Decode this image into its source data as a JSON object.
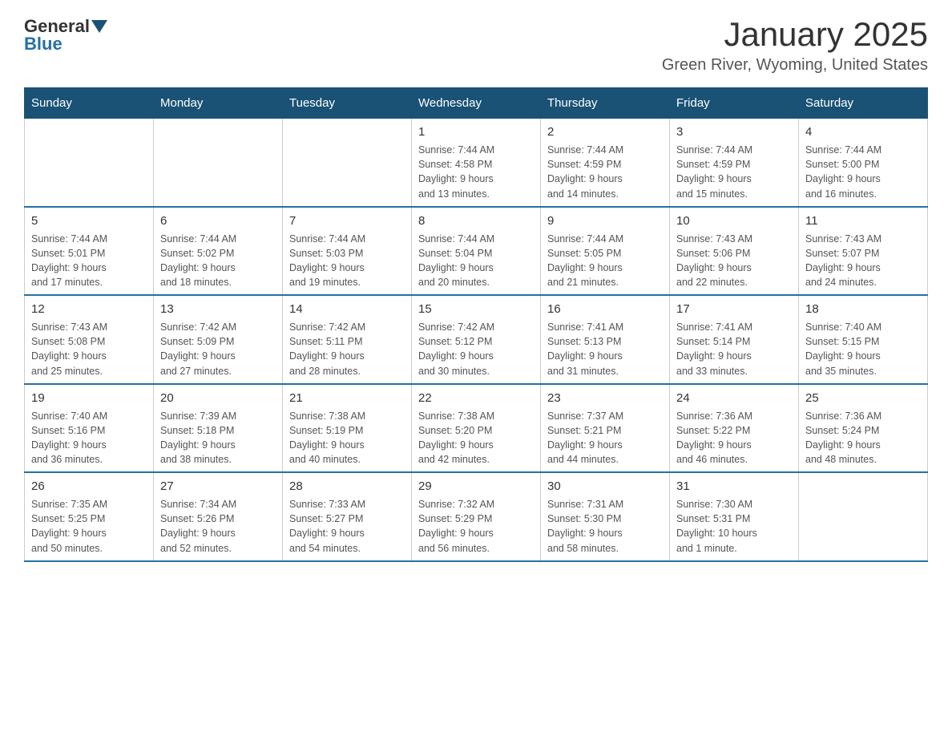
{
  "logo": {
    "general": "General",
    "blue": "Blue"
  },
  "title": "January 2025",
  "subtitle": "Green River, Wyoming, United States",
  "days_of_week": [
    "Sunday",
    "Monday",
    "Tuesday",
    "Wednesday",
    "Thursday",
    "Friday",
    "Saturday"
  ],
  "weeks": [
    [
      {
        "day": "",
        "info": ""
      },
      {
        "day": "",
        "info": ""
      },
      {
        "day": "",
        "info": ""
      },
      {
        "day": "1",
        "info": "Sunrise: 7:44 AM\nSunset: 4:58 PM\nDaylight: 9 hours\nand 13 minutes."
      },
      {
        "day": "2",
        "info": "Sunrise: 7:44 AM\nSunset: 4:59 PM\nDaylight: 9 hours\nand 14 minutes."
      },
      {
        "day": "3",
        "info": "Sunrise: 7:44 AM\nSunset: 4:59 PM\nDaylight: 9 hours\nand 15 minutes."
      },
      {
        "day": "4",
        "info": "Sunrise: 7:44 AM\nSunset: 5:00 PM\nDaylight: 9 hours\nand 16 minutes."
      }
    ],
    [
      {
        "day": "5",
        "info": "Sunrise: 7:44 AM\nSunset: 5:01 PM\nDaylight: 9 hours\nand 17 minutes."
      },
      {
        "day": "6",
        "info": "Sunrise: 7:44 AM\nSunset: 5:02 PM\nDaylight: 9 hours\nand 18 minutes."
      },
      {
        "day": "7",
        "info": "Sunrise: 7:44 AM\nSunset: 5:03 PM\nDaylight: 9 hours\nand 19 minutes."
      },
      {
        "day": "8",
        "info": "Sunrise: 7:44 AM\nSunset: 5:04 PM\nDaylight: 9 hours\nand 20 minutes."
      },
      {
        "day": "9",
        "info": "Sunrise: 7:44 AM\nSunset: 5:05 PM\nDaylight: 9 hours\nand 21 minutes."
      },
      {
        "day": "10",
        "info": "Sunrise: 7:43 AM\nSunset: 5:06 PM\nDaylight: 9 hours\nand 22 minutes."
      },
      {
        "day": "11",
        "info": "Sunrise: 7:43 AM\nSunset: 5:07 PM\nDaylight: 9 hours\nand 24 minutes."
      }
    ],
    [
      {
        "day": "12",
        "info": "Sunrise: 7:43 AM\nSunset: 5:08 PM\nDaylight: 9 hours\nand 25 minutes."
      },
      {
        "day": "13",
        "info": "Sunrise: 7:42 AM\nSunset: 5:09 PM\nDaylight: 9 hours\nand 27 minutes."
      },
      {
        "day": "14",
        "info": "Sunrise: 7:42 AM\nSunset: 5:11 PM\nDaylight: 9 hours\nand 28 minutes."
      },
      {
        "day": "15",
        "info": "Sunrise: 7:42 AM\nSunset: 5:12 PM\nDaylight: 9 hours\nand 30 minutes."
      },
      {
        "day": "16",
        "info": "Sunrise: 7:41 AM\nSunset: 5:13 PM\nDaylight: 9 hours\nand 31 minutes."
      },
      {
        "day": "17",
        "info": "Sunrise: 7:41 AM\nSunset: 5:14 PM\nDaylight: 9 hours\nand 33 minutes."
      },
      {
        "day": "18",
        "info": "Sunrise: 7:40 AM\nSunset: 5:15 PM\nDaylight: 9 hours\nand 35 minutes."
      }
    ],
    [
      {
        "day": "19",
        "info": "Sunrise: 7:40 AM\nSunset: 5:16 PM\nDaylight: 9 hours\nand 36 minutes."
      },
      {
        "day": "20",
        "info": "Sunrise: 7:39 AM\nSunset: 5:18 PM\nDaylight: 9 hours\nand 38 minutes."
      },
      {
        "day": "21",
        "info": "Sunrise: 7:38 AM\nSunset: 5:19 PM\nDaylight: 9 hours\nand 40 minutes."
      },
      {
        "day": "22",
        "info": "Sunrise: 7:38 AM\nSunset: 5:20 PM\nDaylight: 9 hours\nand 42 minutes."
      },
      {
        "day": "23",
        "info": "Sunrise: 7:37 AM\nSunset: 5:21 PM\nDaylight: 9 hours\nand 44 minutes."
      },
      {
        "day": "24",
        "info": "Sunrise: 7:36 AM\nSunset: 5:22 PM\nDaylight: 9 hours\nand 46 minutes."
      },
      {
        "day": "25",
        "info": "Sunrise: 7:36 AM\nSunset: 5:24 PM\nDaylight: 9 hours\nand 48 minutes."
      }
    ],
    [
      {
        "day": "26",
        "info": "Sunrise: 7:35 AM\nSunset: 5:25 PM\nDaylight: 9 hours\nand 50 minutes."
      },
      {
        "day": "27",
        "info": "Sunrise: 7:34 AM\nSunset: 5:26 PM\nDaylight: 9 hours\nand 52 minutes."
      },
      {
        "day": "28",
        "info": "Sunrise: 7:33 AM\nSunset: 5:27 PM\nDaylight: 9 hours\nand 54 minutes."
      },
      {
        "day": "29",
        "info": "Sunrise: 7:32 AM\nSunset: 5:29 PM\nDaylight: 9 hours\nand 56 minutes."
      },
      {
        "day": "30",
        "info": "Sunrise: 7:31 AM\nSunset: 5:30 PM\nDaylight: 9 hours\nand 58 minutes."
      },
      {
        "day": "31",
        "info": "Sunrise: 7:30 AM\nSunset: 5:31 PM\nDaylight: 10 hours\nand 1 minute."
      },
      {
        "day": "",
        "info": ""
      }
    ]
  ]
}
